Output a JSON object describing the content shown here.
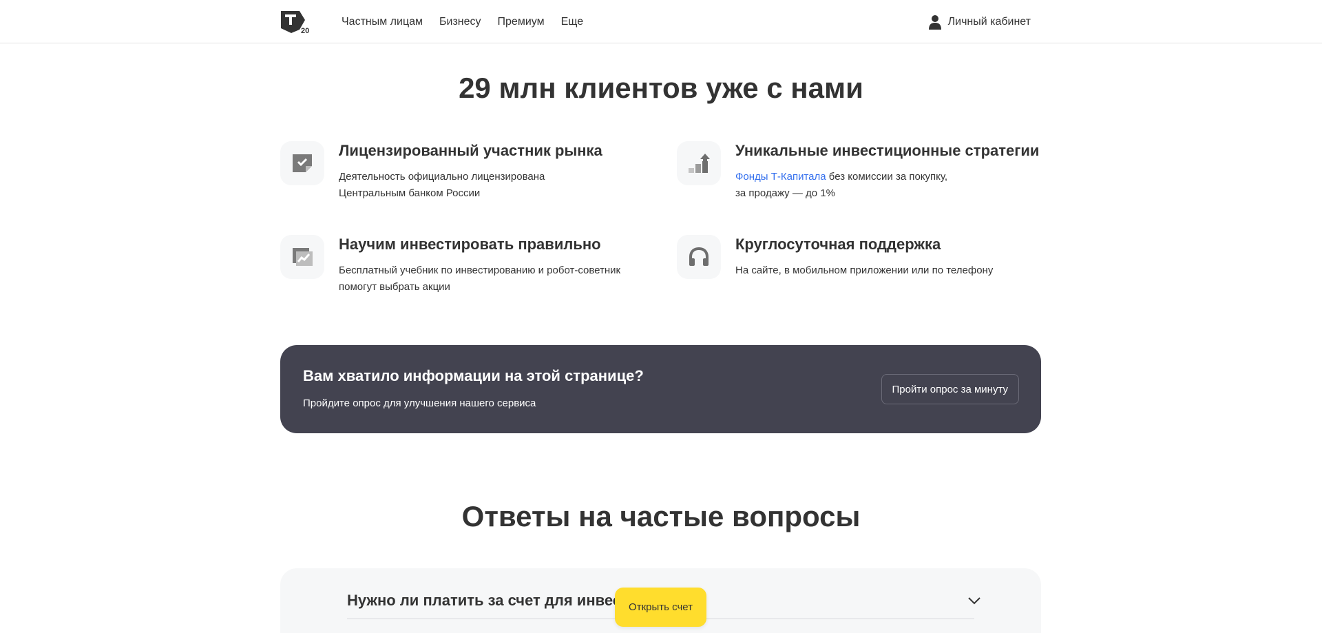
{
  "header": {
    "logo_badge": "20",
    "nav": [
      {
        "label": "Частным лицам"
      },
      {
        "label": "Бизнесу"
      },
      {
        "label": "Премиум"
      },
      {
        "label": "Еще"
      }
    ],
    "account_label": "Личный кабинет"
  },
  "hero": {
    "title": "29 млн клиентов уже с нами"
  },
  "features": [
    {
      "title": "Лицензированный участник рынка",
      "desc_line1": "Деятельность официально лицензирована",
      "desc_line2": "Центральным банком России",
      "icon": "license-check-icon"
    },
    {
      "title": "Уникальные инвестиционные стратегии",
      "link": "Фонды Т-Капитала",
      "desc_rest": " без комиссии за покупку,",
      "desc_line2": "за продажу — до 1%",
      "icon": "growth-chart-icon"
    },
    {
      "title": "Научим инвестировать правильно",
      "desc_line1": "Бесплатный учебник по инвестированию и робот-советник",
      "desc_line2": "помогут выбрать акции",
      "icon": "textbook-chart-icon"
    },
    {
      "title": "Круглосуточная поддержка",
      "desc_line1": "На сайте, в мобильном приложении или по телефону",
      "icon": "headphones-icon"
    }
  ],
  "survey": {
    "title": "Вам хватило информации на этой странице?",
    "subtitle": "Пройдите опрос для улучшения нашего сервиса",
    "button": "Пройти опрос за минуту"
  },
  "faq": {
    "title": "Ответы на частые вопросы",
    "items": [
      {
        "question": "Нужно ли платить за счет для инвест"
      }
    ]
  },
  "sticky": {
    "open_button": "Открыть счет"
  },
  "colors": {
    "accent": "#ffdd2d",
    "survey_bg": "#434350",
    "link": "#336fee",
    "tile_bg": "#f6f7f8"
  }
}
